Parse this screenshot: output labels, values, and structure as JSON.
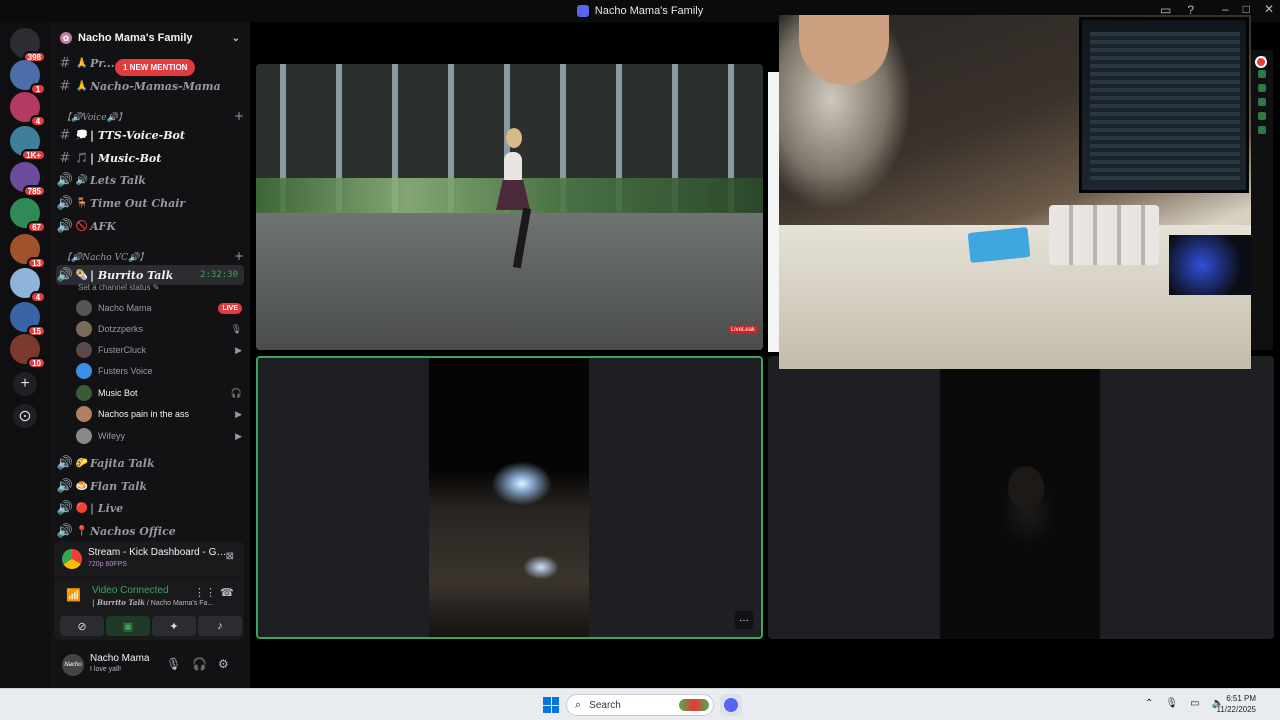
{
  "window": {
    "title": "Nacho Mama's Family"
  },
  "rail": {
    "servers": [
      {
        "name": "discord-home",
        "badge": "398",
        "color": "#2b2d31"
      },
      {
        "name": "server-1",
        "badge": "1",
        "color": "#4b6ea8"
      },
      {
        "name": "server-2",
        "badge": "4",
        "color": "#b33b62"
      },
      {
        "name": "server-3",
        "badge": "1K+",
        "color": "#3f7f9b"
      },
      {
        "name": "server-4",
        "badge": "785",
        "color": "#6b4b9b"
      },
      {
        "name": "server-5",
        "badge": "67",
        "color": "#2e8b57"
      },
      {
        "name": "server-6",
        "badge": "13",
        "color": "#a0522d"
      },
      {
        "name": "server-7",
        "badge": "4",
        "color": "#8fb3d9"
      },
      {
        "name": "server-8",
        "badge": "15",
        "color": "#3a64a8"
      },
      {
        "name": "server-9",
        "badge": "10",
        "color": "#7a3b2e"
      }
    ],
    "add_label": "+",
    "explore_label": "⊙"
  },
  "sidebar": {
    "server_name": "Nacho Mama's Family",
    "mention_pill": "1 NEW MENTION",
    "channels_top": [
      {
        "icon": "#",
        "emoji": "🙏",
        "name": "Pr... ...t"
      },
      {
        "icon": "#",
        "emoji": "🙏",
        "name": "Nacho-Mamas-Mama"
      }
    ],
    "cat_voice": "【🔊Voice🔊】",
    "voice_channels": [
      {
        "icon": "#",
        "emoji": "💭",
        "name": "| TTS-Voice-Bot"
      },
      {
        "icon": "#",
        "emoji": "🎵",
        "name": "| Music-Bot"
      },
      {
        "icon": "🔊",
        "emoji": "🔊",
        "name": "Lets Talk"
      },
      {
        "icon": "🔊",
        "emoji": "🪑",
        "name": "Time Out Chair"
      },
      {
        "icon": "🔊",
        "emoji": "🚫",
        "name": "AFK"
      }
    ],
    "cat_vc": "【🔊Nacho VC🔊】",
    "active_channel": {
      "emoji": "🌯",
      "name": "| Burrito Talk",
      "timer": "2:32:30"
    },
    "channel_status": "Set a channel status ✎",
    "voice_users": [
      {
        "name": "Nacho Mama",
        "right": "LIVE",
        "live": true,
        "on": false,
        "color": "#555"
      },
      {
        "name": "Dotzzperks",
        "right": "🎙",
        "live": false,
        "on": false,
        "color": "#7a6a5a"
      },
      {
        "name": "FusterCluck",
        "right": "▶",
        "live": false,
        "on": false,
        "color": "#5a4a4a"
      },
      {
        "name": "Fusters Voice",
        "right": "",
        "live": false,
        "on": false,
        "color": "#3a8ee6"
      },
      {
        "name": "Music Bot",
        "right": "🎧",
        "live": false,
        "on": true,
        "color": "#3a5a3a"
      },
      {
        "name": "Nachos pain in the ass",
        "right": "▶",
        "live": false,
        "on": true,
        "color": "#b08060"
      },
      {
        "name": "Wifeyy",
        "right": "▶",
        "live": false,
        "on": false,
        "color": "#888"
      }
    ],
    "channels_bottom": [
      {
        "emoji": "🌮",
        "name": "Fajita Talk"
      },
      {
        "emoji": "🍮",
        "name": "Flan Talk"
      },
      {
        "emoji": "🔴",
        "name": "| Live"
      },
      {
        "emoji": "📍",
        "name": "Nachos Office"
      }
    ]
  },
  "stream_panel": {
    "title": "Stream - Kick Dashboard - Google ...",
    "sub": "720p 60FPS"
  },
  "voice_panel": {
    "status": "Video Connected",
    "channel": "| Burrito Talk",
    "server": " / Nacho Mama's Fa..."
  },
  "user_panel": {
    "avatar_text": "Nacho",
    "name": "Nacho Mama",
    "status": "I love yall!"
  },
  "stage": {
    "watermark": "LiveLeak",
    "more_label": "···"
  },
  "taskbar": {
    "search_placeholder": "Search",
    "time": "6:51 PM",
    "date": "11/22/2025"
  },
  "colors": {
    "accent": "#5865f2",
    "live": "#e23c3f",
    "connected": "#3ba55d"
  }
}
